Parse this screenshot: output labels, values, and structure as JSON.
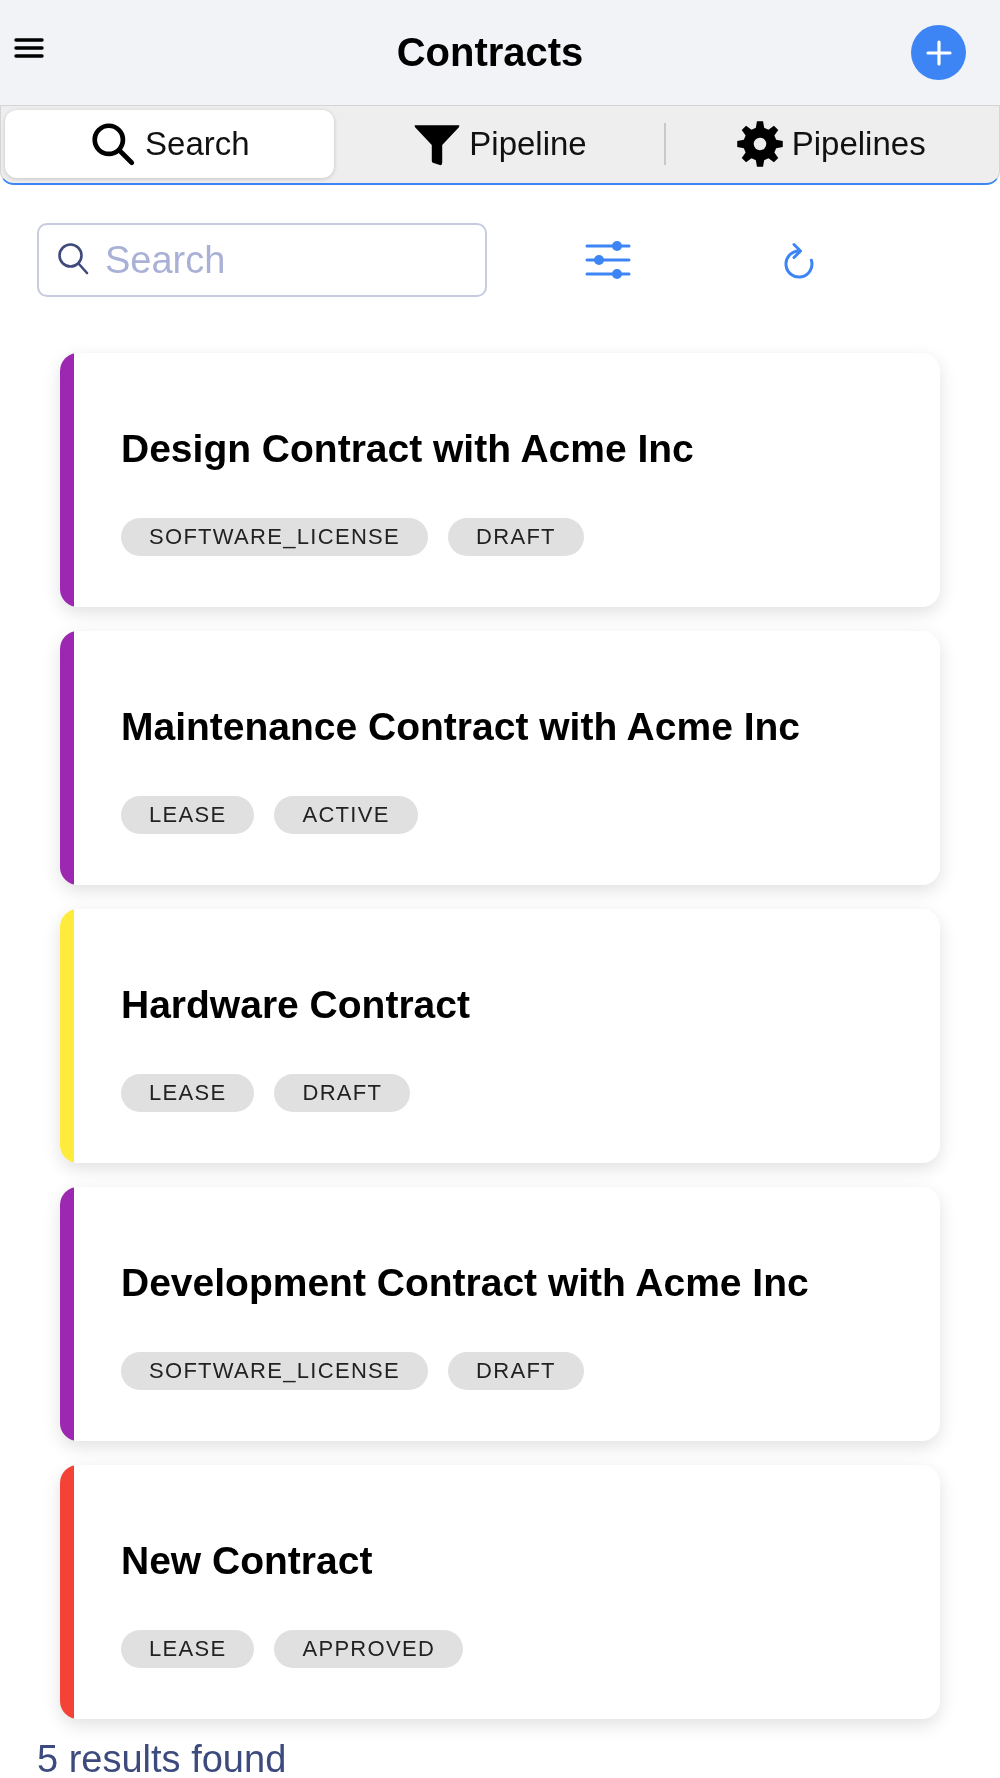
{
  "header": {
    "title": "Contracts"
  },
  "tabs": [
    {
      "label": "Search",
      "selected": true
    },
    {
      "label": "Pipeline",
      "selected": false
    },
    {
      "label": "Pipelines",
      "selected": false
    }
  ],
  "search": {
    "placeholder": "Search"
  },
  "contracts": [
    {
      "title": "Design Contract with Acme Inc",
      "type": "SOFTWARE_LICENSE",
      "status": "DRAFT",
      "color": "#9c27b0"
    },
    {
      "title": "Maintenance Contract with Acme Inc",
      "type": "LEASE",
      "status": "ACTIVE",
      "color": "#9c27b0"
    },
    {
      "title": "Hardware Contract",
      "type": "LEASE",
      "status": "DRAFT",
      "color": "#ffeb3b"
    },
    {
      "title": "Development Contract with Acme Inc",
      "type": "SOFTWARE_LICENSE",
      "status": "DRAFT",
      "color": "#9c27b0"
    },
    {
      "title": "New Contract",
      "type": "LEASE",
      "status": "APPROVED",
      "color": "#f44336"
    }
  ],
  "results": "5 results found"
}
